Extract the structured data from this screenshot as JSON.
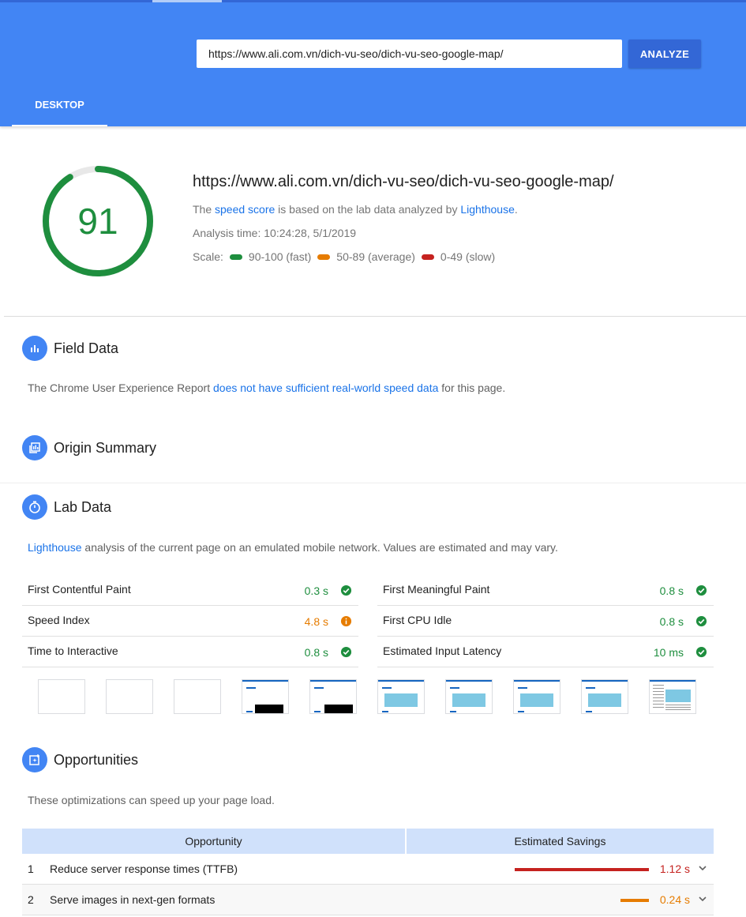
{
  "header": {
    "url_value": "https://www.ali.com.vn/dich-vu-seo/dich-vu-seo-google-map/",
    "analyze_label": "ANALYZE",
    "tab_label": "DESKTOP"
  },
  "score": {
    "value": 91,
    "url": "https://www.ali.com.vn/dich-vu-seo/dich-vu-seo-google-map/",
    "desc_prefix": "The ",
    "speed_score_link": "speed score",
    "desc_middle": " is based on the lab data analyzed by ",
    "lighthouse_link": "Lighthouse",
    "desc_suffix": ".",
    "analysis_time": "Analysis time: 10:24:28, 5/1/2019",
    "scale_label": "Scale:",
    "scale_fast": "90-100 (fast)",
    "scale_average": "50-89 (average)",
    "scale_slow": "0-49 (slow)"
  },
  "colors": {
    "brand_blue": "#4285f4",
    "fast": "#1e8e3e",
    "average": "#e67c00",
    "slow": "#c5221f"
  },
  "field_data": {
    "title": "Field Data",
    "icon": "bar-chart-icon",
    "text_prefix": "The Chrome User Experience Report ",
    "link": "does not have sufficient real-world speed data",
    "text_suffix": " for this page."
  },
  "origin_summary": {
    "title": "Origin Summary",
    "icon": "collection-icon"
  },
  "lab_data": {
    "title": "Lab Data",
    "icon": "stopwatch-icon",
    "link": "Lighthouse",
    "text": " analysis of the current page on an emulated mobile network. Values are estimated and may vary.",
    "metrics_left": [
      {
        "name": "First Contentful Paint",
        "value": "0.3 s",
        "status": "fast"
      },
      {
        "name": "Speed Index",
        "value": "4.8 s",
        "status": "average"
      },
      {
        "name": "Time to Interactive",
        "value": "0.8 s",
        "status": "fast"
      }
    ],
    "metrics_right": [
      {
        "name": "First Meaningful Paint",
        "value": "0.8 s",
        "status": "fast"
      },
      {
        "name": "First CPU Idle",
        "value": "0.8 s",
        "status": "fast"
      },
      {
        "name": "Estimated Input Latency",
        "value": "10 ms",
        "status": "fast"
      }
    ]
  },
  "opportunities": {
    "title": "Opportunities",
    "icon": "opportunity-icon",
    "text": "These optimizations can speed up your page load.",
    "col_opportunity": "Opportunity",
    "col_savings": "Estimated Savings",
    "rows": [
      {
        "index": "1",
        "name": "Reduce server response times (TTFB)",
        "savings": "1.12 s",
        "status": "slow"
      },
      {
        "index": "2",
        "name": "Serve images in next-gen formats",
        "savings": "0.24 s",
        "status": "average"
      }
    ]
  }
}
